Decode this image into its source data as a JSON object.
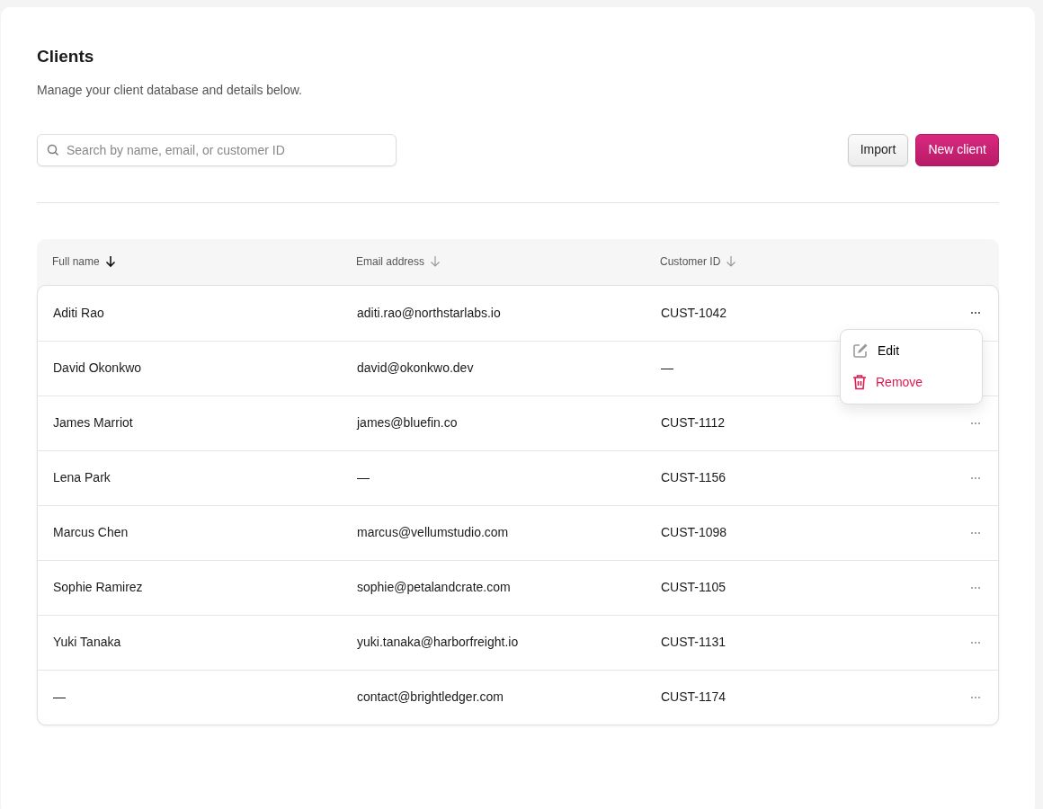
{
  "header": {
    "title": "Clients",
    "subtitle": "Manage your client database and details below."
  },
  "search": {
    "placeholder": "Search by name, email, or customer ID"
  },
  "buttons": [
    {
      "label": "Import",
      "kind": "secondary"
    },
    {
      "label": "New client",
      "kind": "primary"
    }
  ],
  "table": {
    "columns": [
      {
        "label": "Full name",
        "sorted": true
      },
      {
        "label": "Email address",
        "sorted": false
      },
      {
        "label": "Customer ID",
        "sorted": false
      }
    ],
    "rows": [
      {
        "cells": [
          "Aditi Rao",
          "aditi.rao@northstarlabs.io",
          "CUST-1042"
        ],
        "menu_open": true
      },
      {
        "cells": [
          "David Okonkwo",
          "david@okonkwo.dev",
          "—"
        ],
        "menu_open": false
      },
      {
        "cells": [
          "James Marriot",
          "james@bluefin.co",
          "CUST-1112"
        ],
        "menu_open": false
      },
      {
        "cells": [
          "Lena Park",
          "—",
          "CUST-1156"
        ],
        "menu_open": false
      },
      {
        "cells": [
          "Marcus Chen",
          "marcus@vellumstudio.com",
          "CUST-1098"
        ],
        "menu_open": false
      },
      {
        "cells": [
          "Sophie Ramirez",
          "sophie@petalandcrate.com",
          "CUST-1105"
        ],
        "menu_open": false
      },
      {
        "cells": [
          "Yuki Tanaka",
          "yuki.tanaka@harborfreight.io",
          "CUST-1131"
        ],
        "menu_open": false
      },
      {
        "cells": [
          "—",
          "contact@brightledger.com",
          "CUST-1174"
        ],
        "menu_open": false
      }
    ]
  },
  "row_menu": {
    "items": [
      {
        "label": "Edit",
        "kind": "edit"
      },
      {
        "label": "Remove",
        "kind": "remove"
      }
    ]
  }
}
